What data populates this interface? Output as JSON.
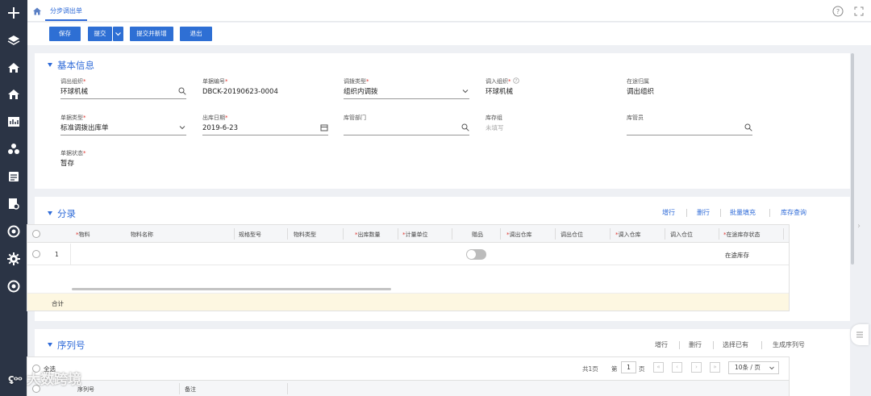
{
  "topbar": {
    "tab_label": "分步调出单"
  },
  "toolbar": {
    "save": "保存",
    "submit": "提交",
    "submit_new": "提交并新增",
    "exit": "退出"
  },
  "basic": {
    "title": "基本信息",
    "fields": {
      "out_org": {
        "label": "调出组织",
        "value": "环球机械"
      },
      "bill_no": {
        "label": "单据编号",
        "value": "DBCK-20190623-0004"
      },
      "transfer_type": {
        "label": "调拨类型",
        "value": "组织内调拨"
      },
      "in_org": {
        "label": "调入组织",
        "value": "环球机械"
      },
      "transit_owner": {
        "label": "在途归属",
        "value": "调出组织"
      },
      "bill_type": {
        "label": "单据类型",
        "value": "标准调拨出库单"
      },
      "out_date": {
        "label": "出库日期",
        "value": "2019-6-23"
      },
      "stock_dept": {
        "label": "库管部门",
        "value": ""
      },
      "stock_group": {
        "label": "库存组",
        "value": "未填写"
      },
      "stock_keeper": {
        "label": "库管员",
        "value": ""
      },
      "bill_status": {
        "label": "单据状态",
        "value": "暂存"
      }
    }
  },
  "entries": {
    "title": "分录",
    "actions": {
      "add_row": "增行",
      "del_row": "删行",
      "batch_fill": "批量填充",
      "stock_query": "库存查询"
    },
    "columns": {
      "material": "物料",
      "material_name": "物料名称",
      "spec": "规格型号",
      "material_type": "物料类型",
      "out_qty": "出库数量",
      "unit": "计量单位",
      "gift": "赠品",
      "out_wh": "调出仓库",
      "out_loc": "调出仓位",
      "in_wh": "调入仓库",
      "in_loc": "调入仓位",
      "transit_status": "在途库存状态"
    },
    "rows": [
      {
        "index": "1",
        "gift_on": false,
        "transit_status": "在途库存"
      }
    ],
    "total_label": "合计"
  },
  "serial": {
    "title": "序列号",
    "actions": {
      "add_row": "增行",
      "del_row": "删行",
      "select_existing": "选择已有",
      "generate": "生成序列号"
    },
    "select_all": "全选",
    "pager": {
      "total_text": "共1页",
      "page_prefix": "第",
      "page_value": "1",
      "page_suffix": "页",
      "page_size": "10条 / 页"
    },
    "columns": {
      "serial_no": "序列号",
      "remark": "备注"
    }
  },
  "watermark": "大数跨境",
  "colors": {
    "accent": "#2f6bd8",
    "button": "#2e6fd4",
    "sidebar": "#2b3445",
    "required": "#e0322b",
    "total_row": "#fdf7e1"
  }
}
